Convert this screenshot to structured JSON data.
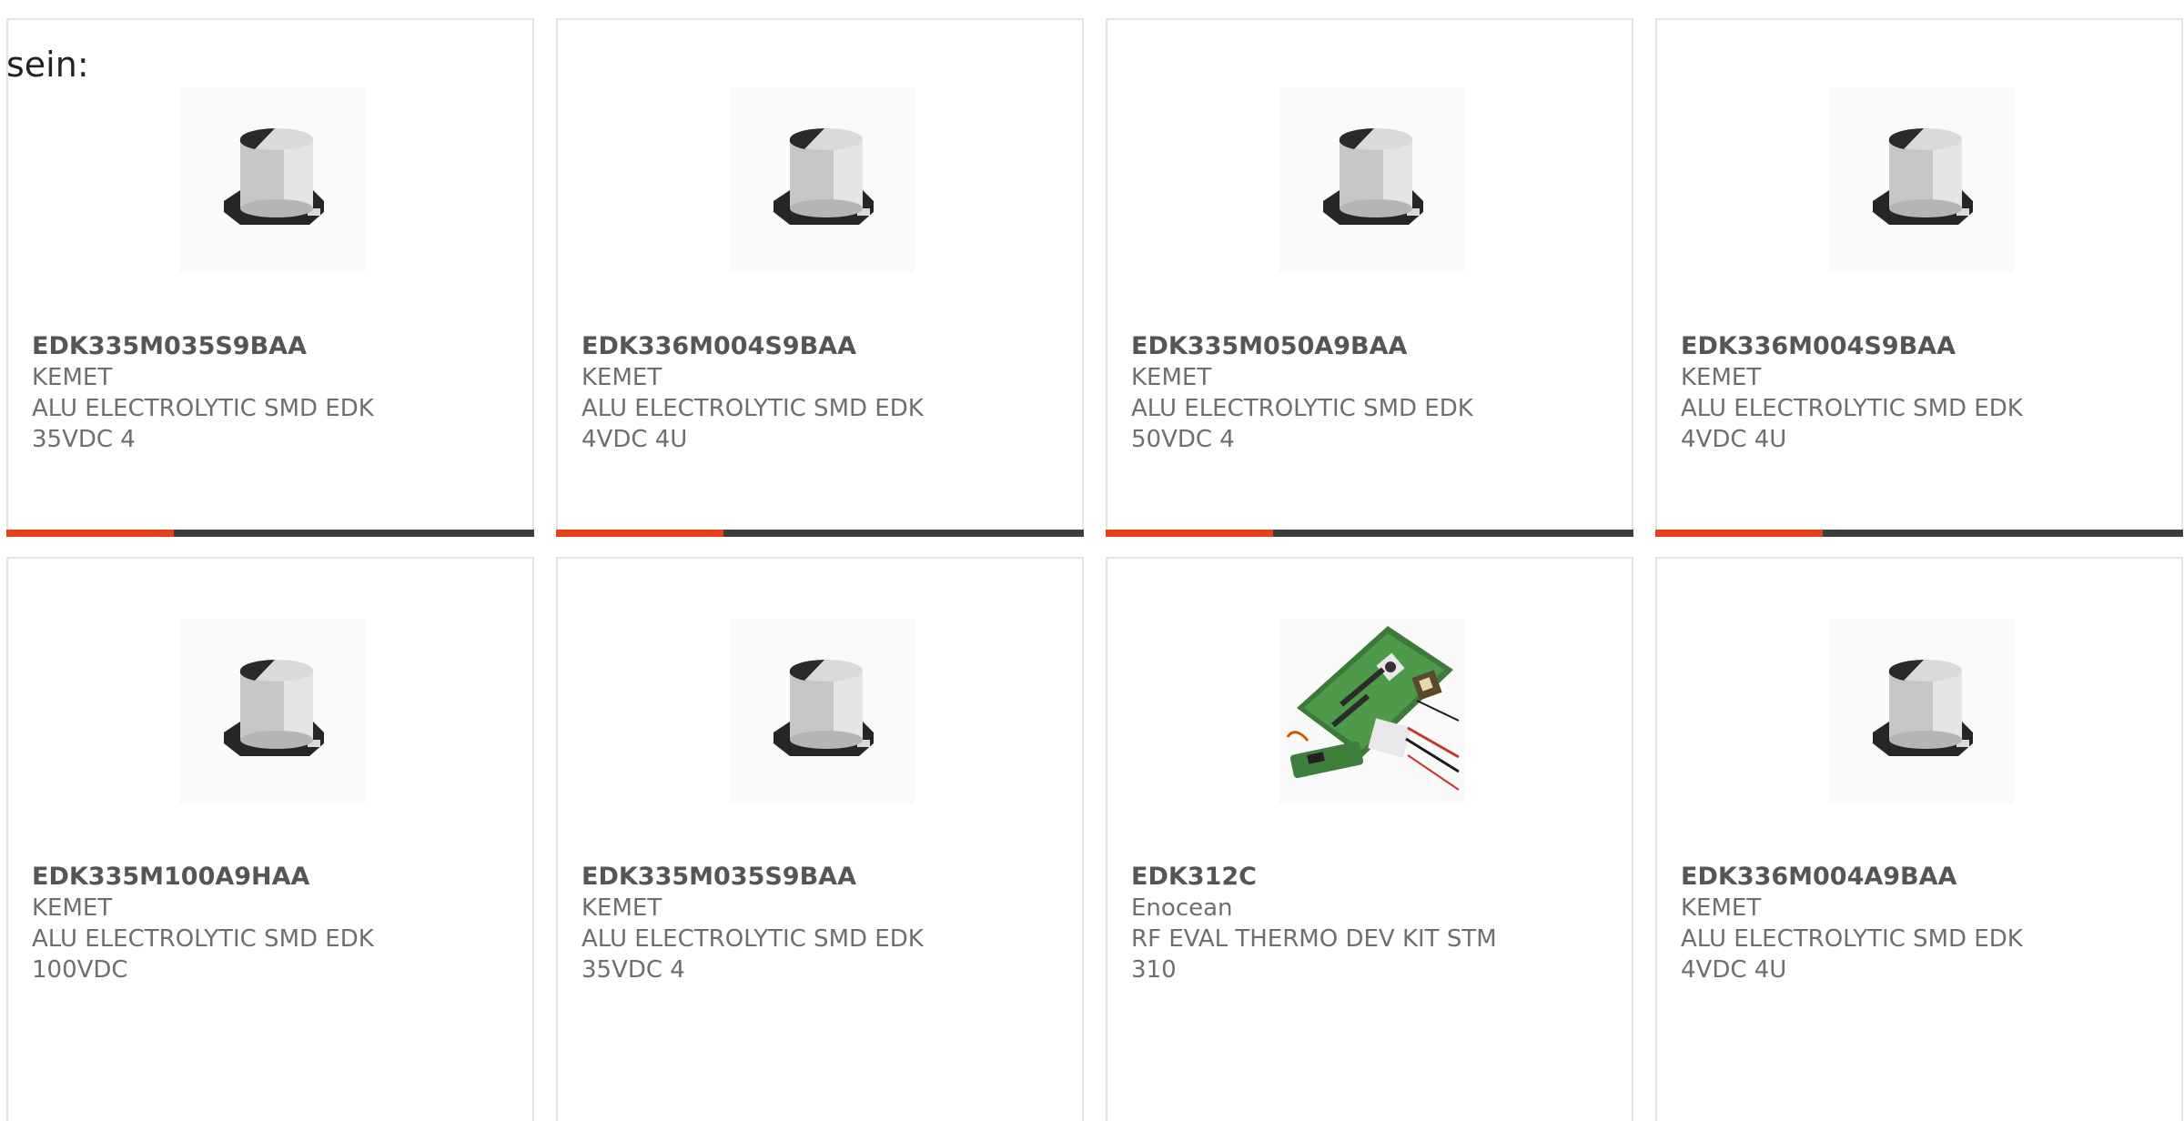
{
  "intro_text": "sein:",
  "products": [
    {
      "part": "EDK335M035S9BAA",
      "manufacturer": "KEMET",
      "desc1": "ALU ELECTROLYTIC SMD EDK",
      "desc2": "35VDC 4",
      "image": "capacitor-icon"
    },
    {
      "part": "EDK336M004S9BAA",
      "manufacturer": "KEMET",
      "desc1": "ALU ELECTROLYTIC SMD EDK",
      "desc2": "4VDC 4U",
      "image": "capacitor-icon"
    },
    {
      "part": "EDK335M050A9BAA",
      "manufacturer": "KEMET",
      "desc1": "ALU ELECTROLYTIC SMD EDK",
      "desc2": "50VDC 4",
      "image": "capacitor-icon"
    },
    {
      "part": "EDK336M004S9BAA",
      "manufacturer": "KEMET",
      "desc1": "ALU ELECTROLYTIC SMD EDK",
      "desc2": "4VDC 4U",
      "image": "capacitor-icon"
    },
    {
      "part": "EDK335M100A9HAA",
      "manufacturer": "KEMET",
      "desc1": "ALU ELECTROLYTIC SMD EDK",
      "desc2": "100VDC",
      "image": "capacitor-icon"
    },
    {
      "part": "EDK335M035S9BAA",
      "manufacturer": "KEMET",
      "desc1": "ALU ELECTROLYTIC SMD EDK",
      "desc2": "35VDC 4",
      "image": "capacitor-icon"
    },
    {
      "part": "EDK312C",
      "manufacturer": "Enocean",
      "desc1": "RF EVAL THERMO DEV KIT STM",
      "desc2": "310",
      "image": "dev-kit-board-icon"
    },
    {
      "part": "EDK336M004A9BAA",
      "manufacturer": "KEMET",
      "desc1": "ALU ELECTROLYTIC SMD EDK",
      "desc2": "4VDC 4U",
      "image": "capacitor-icon"
    }
  ],
  "colors": {
    "accent": "#e8411a",
    "bar": "#3d3d3d",
    "border": "#e4e4e4",
    "text": "#6e6e6e"
  }
}
